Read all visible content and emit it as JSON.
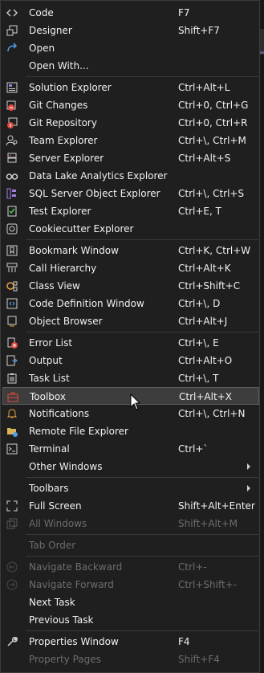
{
  "menu": {
    "items": [
      {
        "label": "Code",
        "shortcut": "F7",
        "icon": "code-icon"
      },
      {
        "label": "Designer",
        "shortcut": "Shift+F7",
        "icon": "designer-icon"
      },
      {
        "label": "Open",
        "shortcut": "",
        "icon": "open-icon"
      },
      {
        "label": "Open With...",
        "shortcut": "",
        "icon": ""
      },
      {
        "label": "Solution Explorer",
        "shortcut": "Ctrl+Alt+L",
        "icon": "solution-explorer-icon"
      },
      {
        "label": "Git Changes",
        "shortcut": "Ctrl+0, Ctrl+G",
        "icon": "git-changes-icon"
      },
      {
        "label": "Git Repository",
        "shortcut": "Ctrl+0, Ctrl+R",
        "icon": "git-repository-icon"
      },
      {
        "label": "Team Explorer",
        "shortcut": "Ctrl+\\, Ctrl+M",
        "icon": "team-explorer-icon"
      },
      {
        "label": "Server Explorer",
        "shortcut": "Ctrl+Alt+S",
        "icon": "server-explorer-icon"
      },
      {
        "label": "Data Lake Analytics Explorer",
        "shortcut": "",
        "icon": "data-lake-icon"
      },
      {
        "label": "SQL Server Object Explorer",
        "shortcut": "Ctrl+\\, Ctrl+S",
        "icon": "sql-server-icon"
      },
      {
        "label": "Test Explorer",
        "shortcut": "Ctrl+E, T",
        "icon": "test-explorer-icon"
      },
      {
        "label": "Cookiecutter Explorer",
        "shortcut": "",
        "icon": "cookiecutter-icon"
      },
      {
        "label": "Bookmark Window",
        "shortcut": "Ctrl+K, Ctrl+W",
        "icon": "bookmark-icon"
      },
      {
        "label": "Call Hierarchy",
        "shortcut": "Ctrl+Alt+K",
        "icon": "call-hierarchy-icon"
      },
      {
        "label": "Class View",
        "shortcut": "Ctrl+Shift+C",
        "icon": "class-view-icon"
      },
      {
        "label": "Code Definition Window",
        "shortcut": "Ctrl+\\, D",
        "icon": "code-definition-icon"
      },
      {
        "label": "Object Browser",
        "shortcut": "Ctrl+Alt+J",
        "icon": "object-browser-icon"
      },
      {
        "label": "Error List",
        "shortcut": "Ctrl+\\, E",
        "icon": "error-list-icon"
      },
      {
        "label": "Output",
        "shortcut": "Ctrl+Alt+O",
        "icon": "output-icon"
      },
      {
        "label": "Task List",
        "shortcut": "Ctrl+\\, T",
        "icon": "task-list-icon"
      },
      {
        "label": "Toolbox",
        "shortcut": "Ctrl+Alt+X",
        "icon": "toolbox-icon",
        "highlighted": true
      },
      {
        "label": "Notifications",
        "shortcut": "Ctrl+\\, Ctrl+N",
        "icon": "bell-icon"
      },
      {
        "label": "Remote File Explorer",
        "shortcut": "",
        "icon": "remote-file-icon"
      },
      {
        "label": "Terminal",
        "shortcut": "Ctrl+`",
        "icon": "terminal-icon"
      },
      {
        "label": "Other Windows",
        "shortcut": "",
        "icon": "",
        "submenu": true
      },
      {
        "label": "Toolbars",
        "shortcut": "",
        "icon": "",
        "submenu": true
      },
      {
        "label": "Full Screen",
        "shortcut": "Shift+Alt+Enter",
        "icon": "full-screen-icon"
      },
      {
        "label": "All Windows",
        "shortcut": "Shift+Alt+M",
        "icon": "all-windows-icon",
        "disabled": true
      },
      {
        "label": "Tab Order",
        "shortcut": "",
        "icon": "",
        "disabled": true
      },
      {
        "label": "Navigate Backward",
        "shortcut": "Ctrl+-",
        "icon": "navigate-backward-icon",
        "disabled": true
      },
      {
        "label": "Navigate Forward",
        "shortcut": "Ctrl+Shift+-",
        "icon": "navigate-forward-icon",
        "disabled": true
      },
      {
        "label": "Next Task",
        "shortcut": "",
        "icon": ""
      },
      {
        "label": "Previous Task",
        "shortcut": "",
        "icon": ""
      },
      {
        "label": "Properties Window",
        "shortcut": "F4",
        "icon": "wrench-icon"
      },
      {
        "label": "Property Pages",
        "shortcut": "Shift+F4",
        "icon": "",
        "disabled": true
      }
    ]
  },
  "colors": {
    "background": "#1f1f1f",
    "text": "#f1f1f1",
    "disabled": "#6d6d6d",
    "highlight": "#3d3d3d"
  }
}
